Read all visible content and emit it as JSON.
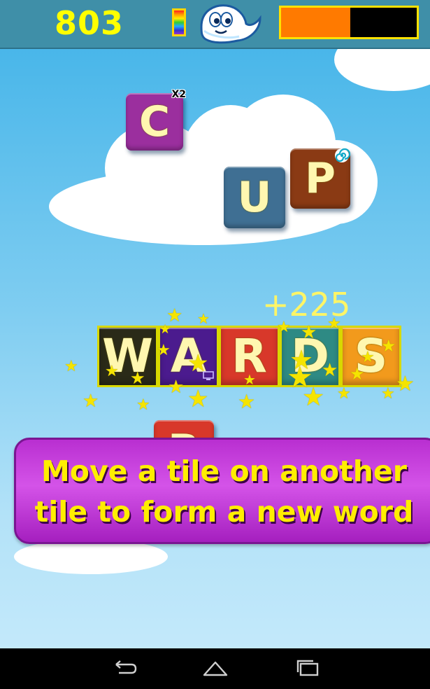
{
  "hud": {
    "score": "803",
    "timer_fill_fraction": 0.51,
    "timer_fill_color": "#ff7a00",
    "timer_empty_color": "#000000"
  },
  "floating_tiles": [
    {
      "letter": "C",
      "color": "#9b2f9e",
      "badge": "X2"
    },
    {
      "letter": "U",
      "color": "#3f6f93"
    },
    {
      "letter": "P",
      "color": "#8a3a14",
      "badge_icon": "spiral-icon"
    }
  ],
  "word": {
    "letters": [
      {
        "letter": "W",
        "color": "#2a2a18"
      },
      {
        "letter": "A",
        "color": "#4b1b8e",
        "badge_icon": "monitor-icon"
      },
      {
        "letter": "R",
        "color": "#d8382a"
      },
      {
        "letter": "D",
        "color": "#2e8a84"
      },
      {
        "letter": "S",
        "color": "#f29a1c"
      }
    ],
    "bonus": "+225"
  },
  "partial_tile": {
    "letter": "B",
    "color": "#d8382a"
  },
  "hint": {
    "line1": "Move a tile on another",
    "line2": "tile to form a new word"
  },
  "navbar": {
    "buttons": [
      "back-icon",
      "home-icon",
      "recent-apps-icon"
    ]
  }
}
